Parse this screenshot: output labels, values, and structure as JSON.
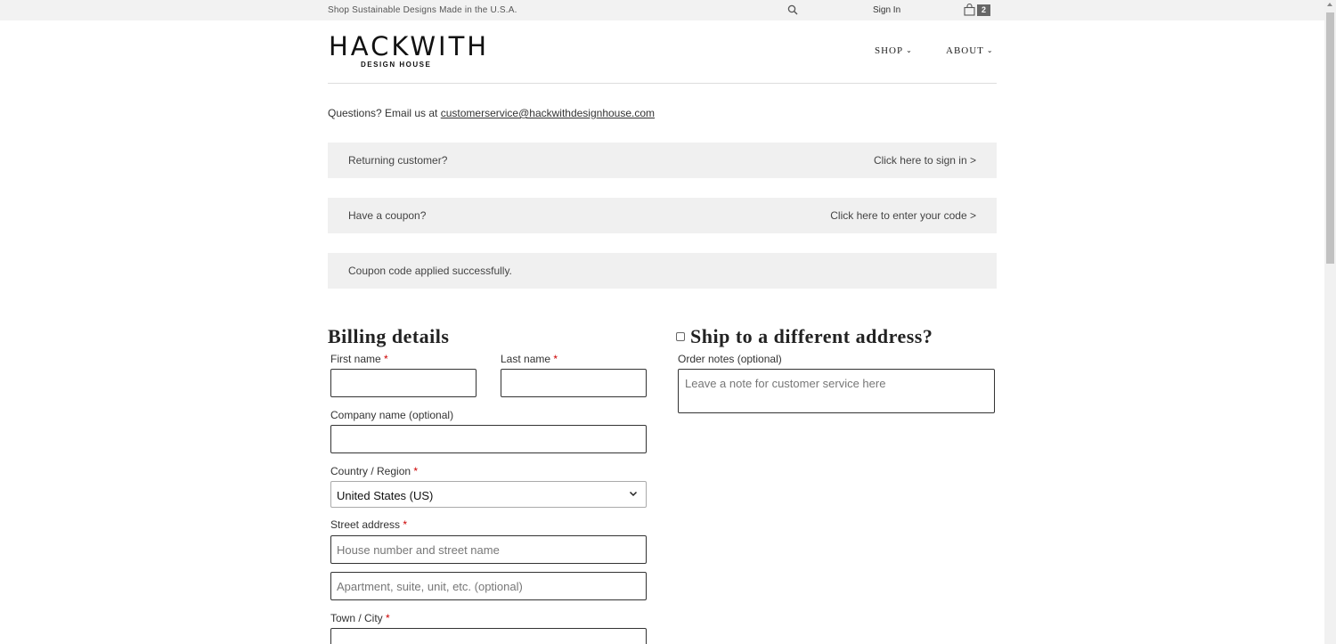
{
  "topbar": {
    "promo": "Shop Sustainable Designs Made in the U.S.A.",
    "search_icon": "search-icon",
    "signin": "Sign In",
    "bag_icon": "shopping-bag-icon",
    "cart_count": "2"
  },
  "header": {
    "logo_main": "HACKWITH",
    "logo_sub": "DESIGN HOUSE",
    "nav": [
      {
        "label": "SHOP"
      },
      {
        "label": "ABOUT"
      }
    ]
  },
  "questions": {
    "text": "Questions? Email us at ",
    "email": "customerservice@hackwithdesignhouse.com"
  },
  "notices": {
    "returning": {
      "left": "Returning customer?",
      "right": "Click here to sign in >"
    },
    "coupon": {
      "left": "Have a coupon?",
      "right": "Click here to enter your code >"
    },
    "applied": "Coupon code applied successfully."
  },
  "billing": {
    "title": "Billing details",
    "first_name": "First name",
    "last_name": "Last name",
    "company": "Company name (optional)",
    "country_label": "Country / Region",
    "country_value": "United States (US)",
    "street_label": "Street address",
    "street_placeholder": "House number and street name",
    "street2_placeholder": "Apartment, suite, unit, etc. (optional)",
    "city_label": "Town / City",
    "required_mark": "*"
  },
  "shipping": {
    "title": "Ship to a different address?",
    "notes_label": "Order notes (optional)",
    "notes_placeholder": "Leave a note for customer service here"
  },
  "colors": {
    "required": "#cc0000",
    "notice_bg": "#f0f0f0",
    "topbar_bg": "#f2f2f2"
  }
}
